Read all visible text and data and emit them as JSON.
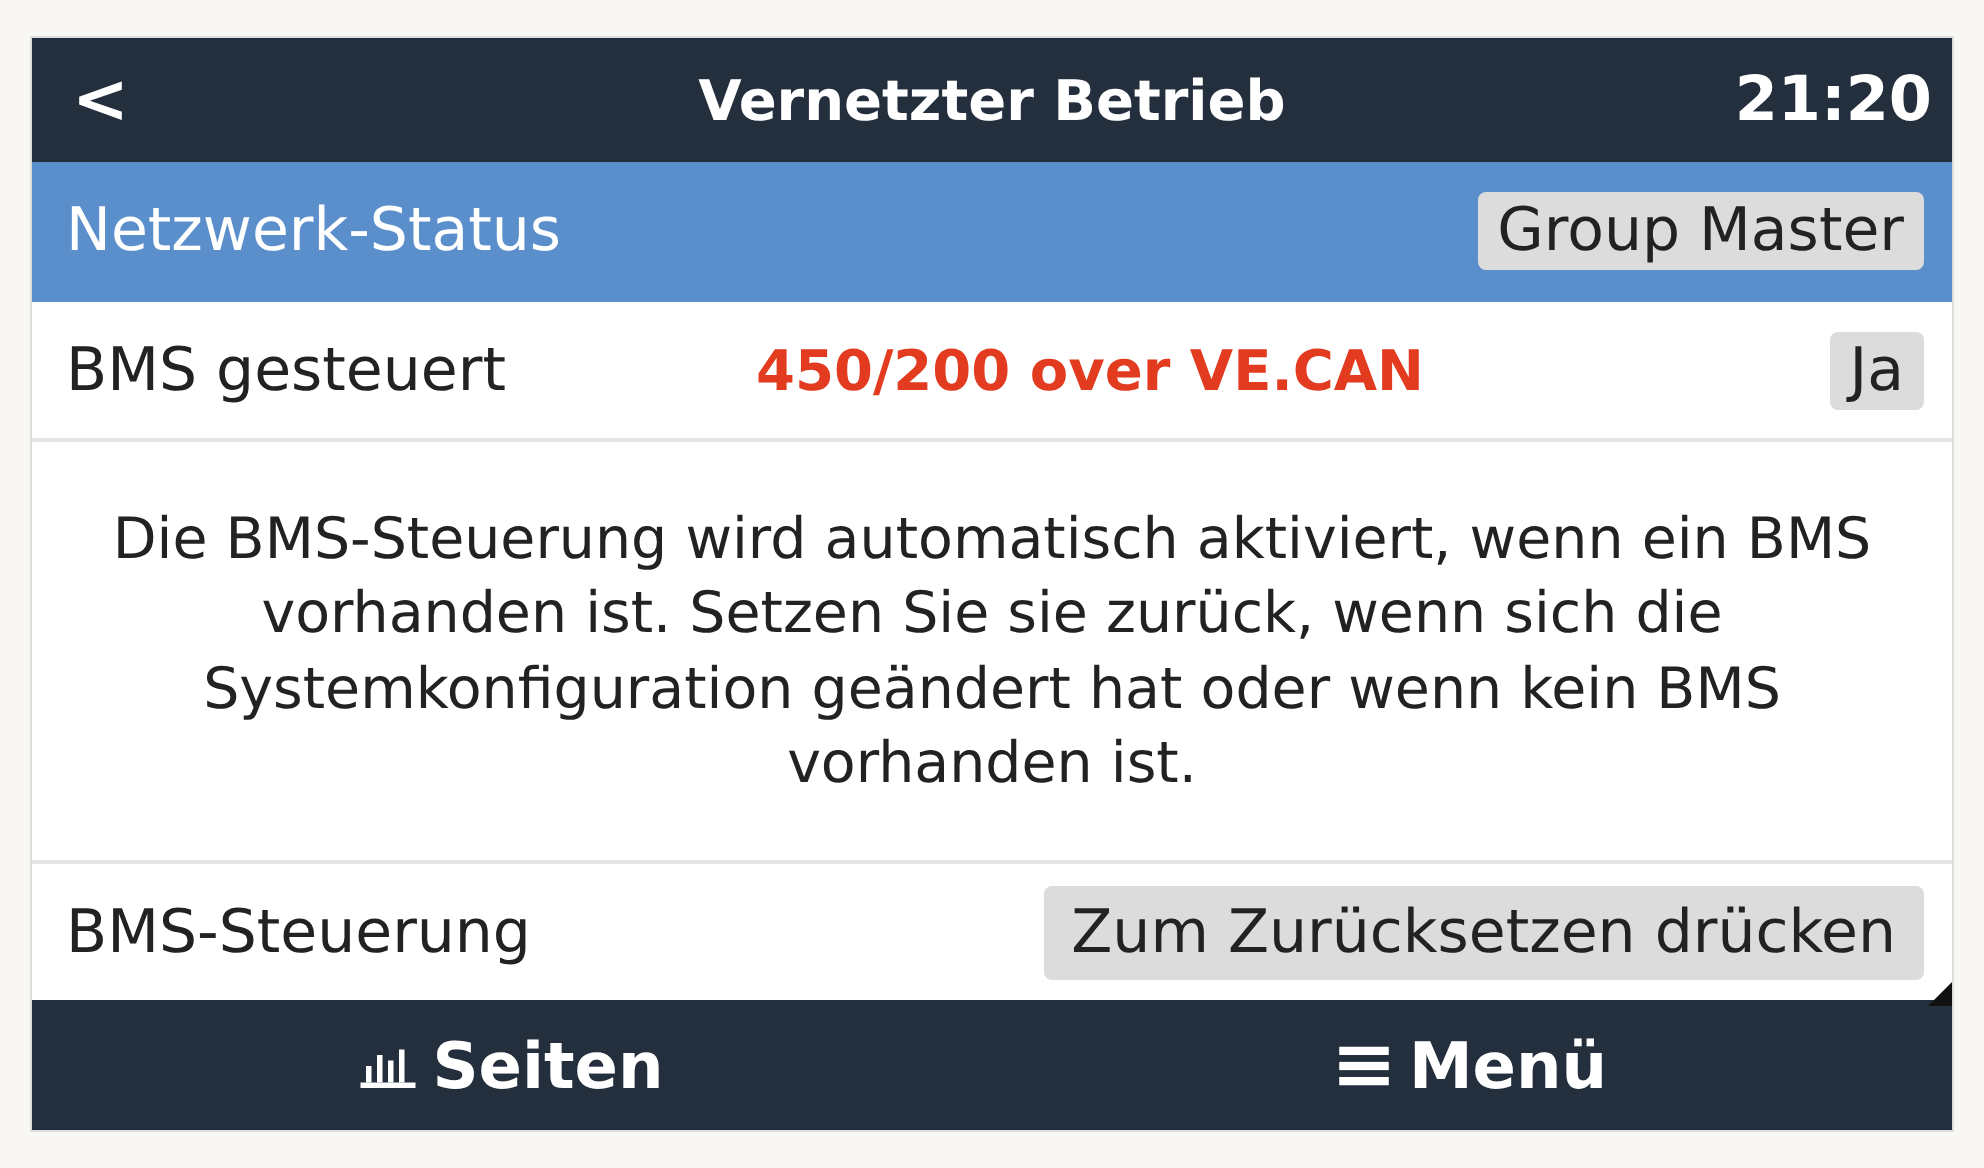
{
  "header": {
    "back": "<",
    "title": "Vernetzter Betrieb",
    "time": "21:20"
  },
  "rows": [
    {
      "kind": "value",
      "label": "Netzwerk-Status",
      "value": "Group Master",
      "selected": true
    },
    {
      "kind": "value",
      "label": "BMS gesteuert",
      "value": "Ja",
      "selected": false,
      "annotation": "450/200 over VE.CAN"
    },
    {
      "kind": "info",
      "text": "Die BMS-Steuerung wird automatisch aktiviert, wenn ein BMS vorhanden ist. Setzen Sie sie zurück, wenn sich die Systemkonfiguration geändert hat oder wenn kein BMS vorhanden ist."
    },
    {
      "kind": "button",
      "label": "BMS-Steuerung",
      "value": "Zum Zurücksetzen drücken",
      "selected": false
    }
  ],
  "footer": {
    "left": "Seiten",
    "right": "Menü"
  }
}
